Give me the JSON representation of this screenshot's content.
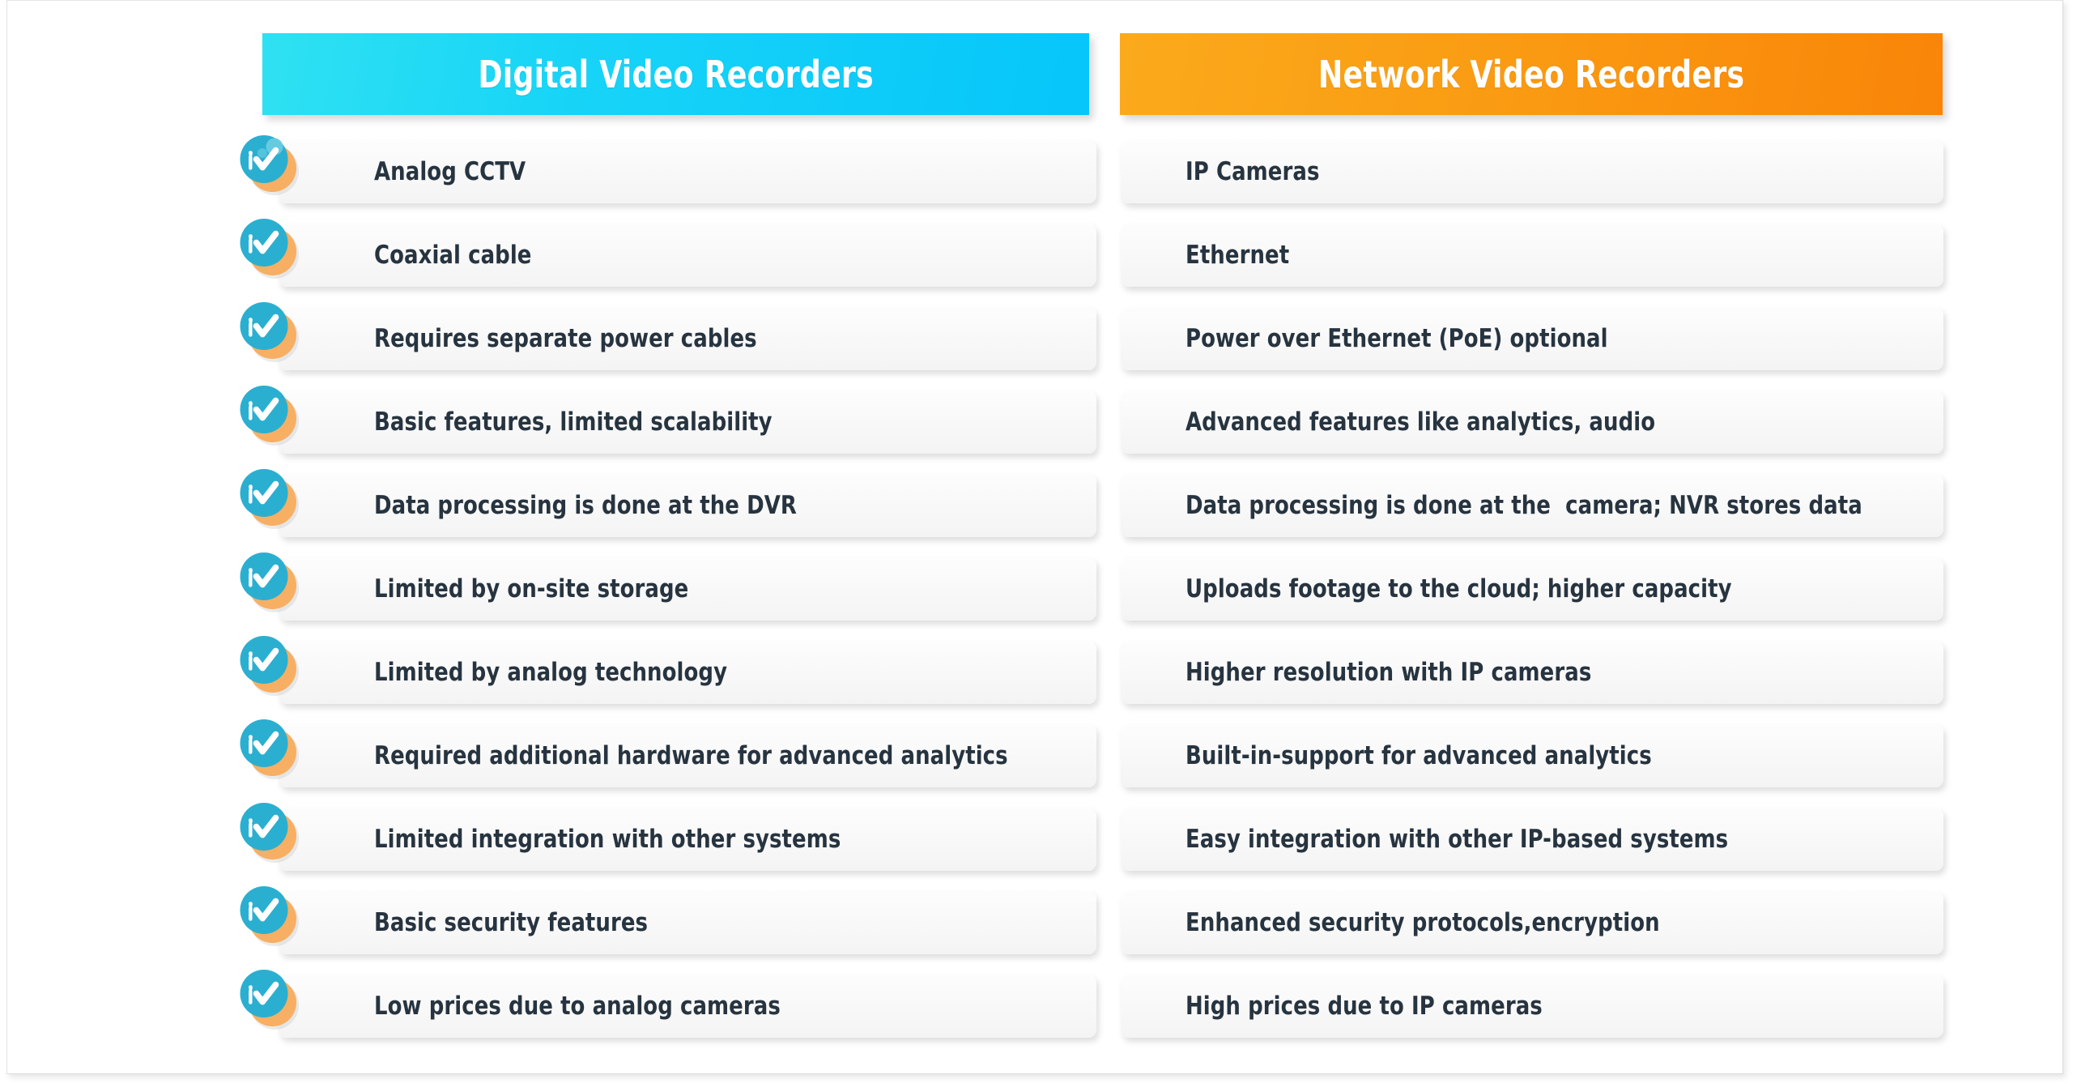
{
  "slide": {
    "title": "Digital Video Recorders vs Network Video Recorders comparison"
  },
  "colors": {
    "dvr_header_gradient_start": "#2FE1F2",
    "dvr_header_gradient_end": "#06C6FA",
    "nvr_header_gradient_start": "#FBAA1C",
    "nvr_header_gradient_end": "#F98508",
    "row_text": "#273440",
    "badge_circle": "#2BAFD0",
    "badge_shadow_circle": "#F7AF63",
    "badge_check": "#FFFFFF",
    "page_background": "#FFFFFF"
  },
  "columns": {
    "dvr": {
      "header": "Digital Video Recorders",
      "icon": "check-badge-icon",
      "rows": [
        {
          "label": "Analog CCTV"
        },
        {
          "label": "Coaxial cable"
        },
        {
          "label": "Requires separate power cables"
        },
        {
          "label": "Basic features, limited scalability"
        },
        {
          "label": "Data processing is done at the DVR"
        },
        {
          "label": "Limited by on-site storage"
        },
        {
          "label": "Limited by analog technology"
        },
        {
          "label": "Required additional hardware for advanced analytics"
        },
        {
          "label": "Limited integration with other systems"
        },
        {
          "label": "Basic security features"
        },
        {
          "label": "Low prices due to analog cameras"
        }
      ]
    },
    "nvr": {
      "header": "Network Video Recorders",
      "rows": [
        {
          "label": "IP Cameras"
        },
        {
          "label": "Ethernet"
        },
        {
          "label": "Power over Ethernet (PoE) optional"
        },
        {
          "label": "Advanced features like analytics, audio"
        },
        {
          "label": "Data processing is done at the  camera; NVR stores data"
        },
        {
          "label": "Uploads footage to the cloud; higher capacity"
        },
        {
          "label": "Higher resolution with IP cameras"
        },
        {
          "label": "Built-in-support for advanced analytics"
        },
        {
          "label": "Easy integration with other IP-based systems"
        },
        {
          "label": "Enhanced security protocols,encryption"
        },
        {
          "label": "High prices due to IP cameras"
        }
      ]
    }
  }
}
